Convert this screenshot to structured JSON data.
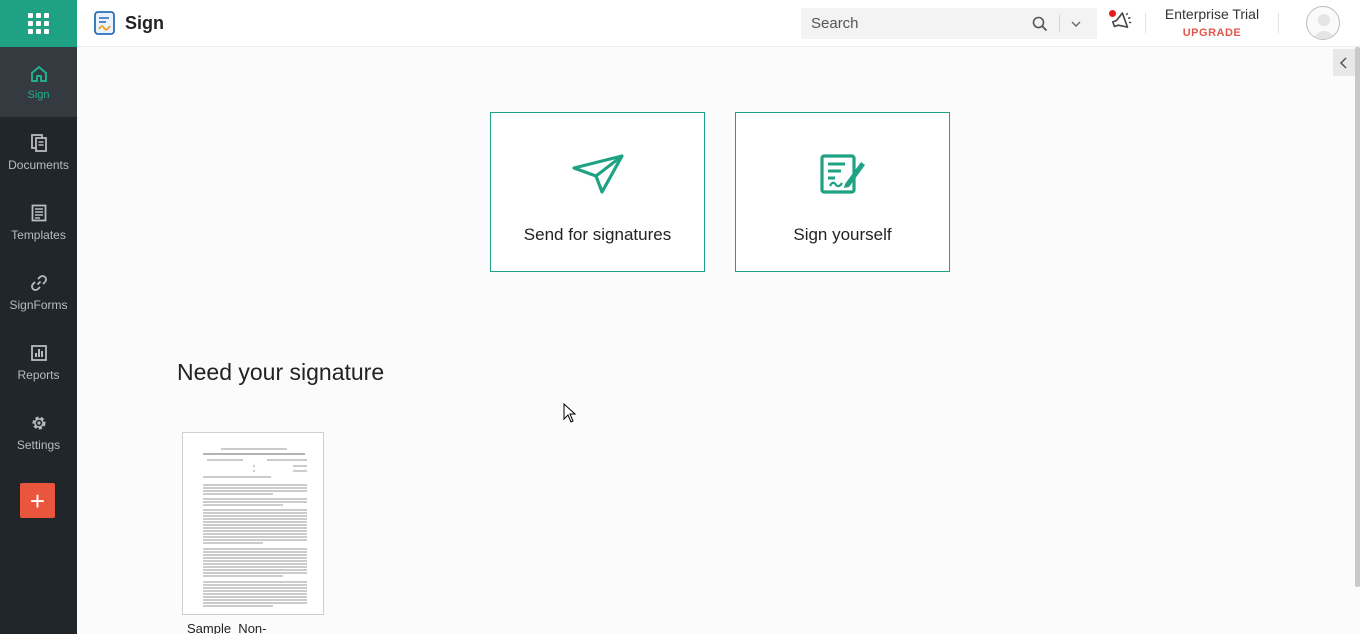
{
  "app": {
    "name": "Sign"
  },
  "search": {
    "placeholder": "Search"
  },
  "plan": {
    "name": "Enterprise Trial",
    "upgrade_label": "UPGRADE"
  },
  "sidebar": {
    "items": [
      {
        "label": "Sign",
        "icon": "home-icon",
        "active": true
      },
      {
        "label": "Documents",
        "icon": "documents-icon"
      },
      {
        "label": "Templates",
        "icon": "templates-icon"
      },
      {
        "label": "SignForms",
        "icon": "link-icon"
      },
      {
        "label": "Reports",
        "icon": "reports-icon"
      },
      {
        "label": "Settings",
        "icon": "gear-icon"
      }
    ],
    "add_label": "+"
  },
  "actions": [
    {
      "label": "Send for signatures",
      "icon": "paper-plane-icon"
    },
    {
      "label": "Sign yourself",
      "icon": "sign-document-icon"
    }
  ],
  "section": {
    "title": "Need your signature"
  },
  "documents": [
    {
      "name": "Sample  Non-"
    }
  ],
  "colors": {
    "accent": "#1fa183",
    "sidebar": "#21262b",
    "upgrade": "#e2574c",
    "add_button": "#e9553d"
  }
}
